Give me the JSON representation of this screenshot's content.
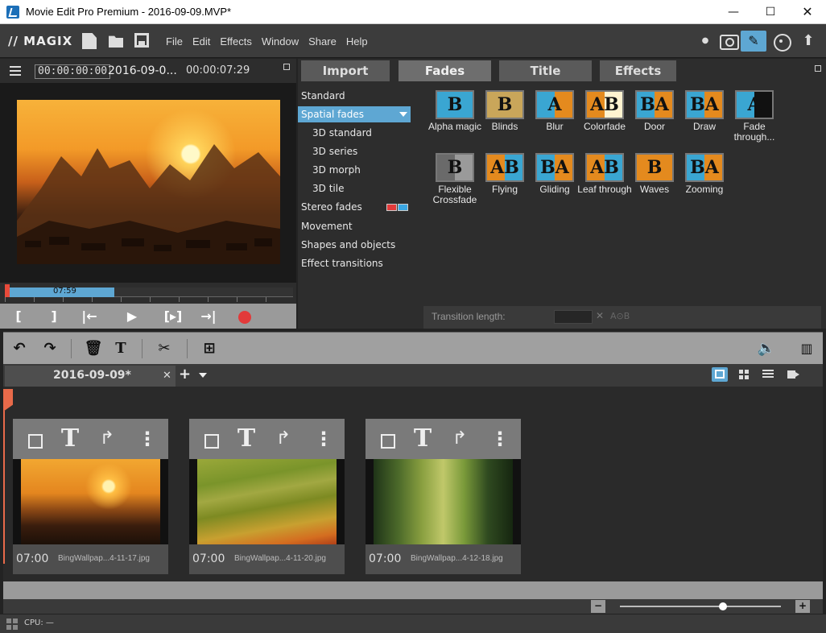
{
  "window": {
    "title": "Movie Edit Pro Premium - 2016-09-09.MVP*",
    "min_glyph": "—",
    "max_glyph": "☐",
    "close_glyph": "✕"
  },
  "menubar": {
    "logo": "// MAGIX",
    "menus": [
      "File",
      "Edit",
      "Effects",
      "Window",
      "Share",
      "Help"
    ],
    "icons": [
      "new-document-icon",
      "open-folder-icon",
      "save-icon",
      "dot-icon",
      "record-camera-icon",
      "brush-icon",
      "disc-icon",
      "upload-icon"
    ],
    "dot_glyph": "●",
    "upload_glyph": "⬆",
    "brush_glyph": "✎"
  },
  "preview": {
    "timecode_current": "00:00:00:00",
    "project_name": "2016-09-0...",
    "timecode_total": "00:00:07:29",
    "scrub_label": "07:59",
    "scrub_progress": 0.38,
    "transport": [
      "[",
      "]",
      "|←",
      "▶",
      "[▸]",
      "→|"
    ]
  },
  "media": {
    "tabs": [
      "Import",
      "Fades",
      "Title",
      "Effects"
    ],
    "active_tab": "Fades",
    "categories": [
      {
        "label": "Standard",
        "sub": false
      },
      {
        "label": "Spatial fades",
        "sub": false,
        "active": true
      },
      {
        "label": "3D standard",
        "sub": true
      },
      {
        "label": "3D series",
        "sub": true
      },
      {
        "label": "3D morph",
        "sub": true
      },
      {
        "label": "3D tile",
        "sub": true
      },
      {
        "label": "Stereo fades",
        "sub": false
      },
      {
        "label": "Movement",
        "sub": false
      },
      {
        "label": "Shapes and objects",
        "sub": false
      },
      {
        "label": "Effect transitions",
        "sub": false
      }
    ],
    "fades": [
      {
        "label": "Alpha magic",
        "letters": "B",
        "a": "#3aa6d2",
        "b": "#3aa6d2"
      },
      {
        "label": "Blinds",
        "letters": "B",
        "a": "#c9a65a",
        "b": "#c9a65a"
      },
      {
        "label": "Blur",
        "letters": "A",
        "a": "#3aa6d2",
        "b": "#e48a1e"
      },
      {
        "label": "Colorfade",
        "letters": "AB",
        "a": "#e48a1e",
        "b": "#fff3d0"
      },
      {
        "label": "Door",
        "letters": "BA",
        "a": "#3aa6d2",
        "b": "#e48a1e"
      },
      {
        "label": "Draw",
        "letters": "BA",
        "a": "#3aa6d2",
        "b": "#e48a1e"
      },
      {
        "label": "Fade through...",
        "letters": "A",
        "a": "#3aa6d2",
        "b": "#111111"
      },
      {
        "label": "Flexible Crossfade",
        "letters": "B",
        "a": "#6a6a6a",
        "b": "#9a9a9a"
      },
      {
        "label": "Flying",
        "letters": "AB",
        "a": "#e48a1e",
        "b": "#3aa6d2"
      },
      {
        "label": "Gliding",
        "letters": "BA",
        "a": "#3aa6d2",
        "b": "#e48a1e"
      },
      {
        "label": "Leaf through",
        "letters": "AB",
        "a": "#e48a1e",
        "b": "#3aa6d2"
      },
      {
        "label": "Waves",
        "letters": "B",
        "a": "#e48a1e",
        "b": "#e48a1e"
      },
      {
        "label": "Zooming",
        "letters": "BA",
        "a": "#3aa6d2",
        "b": "#e48a1e"
      }
    ],
    "transition_label": "Transition length:",
    "transition_value": "",
    "transition_clear": "✕",
    "transition_ab": "A⊙B"
  },
  "timeline_toolbar": {
    "undo": "↶",
    "redo": "↷",
    "delete": "🗑",
    "text": "T",
    "cut": "✂",
    "insert": "⊞",
    "volume": "🔈",
    "meter": "▥"
  },
  "project": {
    "tab_name": "2016-09-09*",
    "close": "✕",
    "add": "+"
  },
  "clips": [
    {
      "duration": "07:00",
      "filename": "BingWallpap...4-11-17.jpg",
      "variant": "img-a"
    },
    {
      "duration": "07:00",
      "filename": "BingWallpap...4-11-20.jpg",
      "variant": "img-b"
    },
    {
      "duration": "07:00",
      "filename": "BingWallpap...4-12-18.jpg",
      "variant": "img-c"
    }
  ],
  "clip_tools": {
    "text": "T",
    "rotate": "↱",
    "more": "⋮"
  },
  "zoom": {
    "minus": "−",
    "plus": "+",
    "level": 0.64
  },
  "status": {
    "cpu": "CPU: —"
  }
}
